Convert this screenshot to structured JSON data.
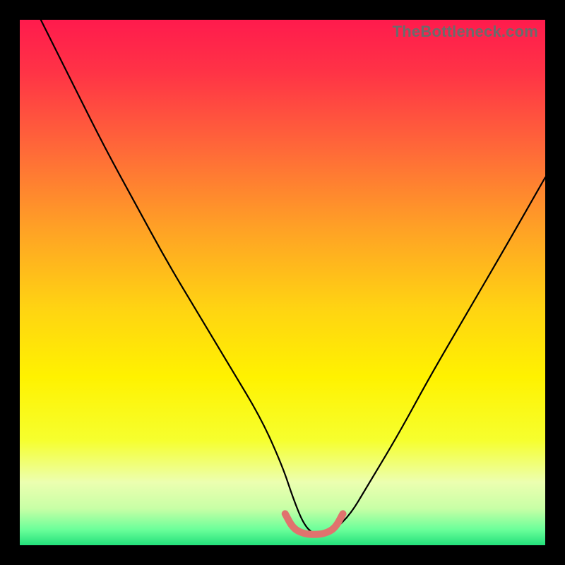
{
  "watermark": "TheBottleneck.com",
  "chart_data": {
    "type": "line",
    "title": "",
    "xlabel": "",
    "ylabel": "",
    "xlim": [
      0,
      100
    ],
    "ylim": [
      0,
      100
    ],
    "series": [
      {
        "name": "bottleneck-curve",
        "x": [
          4,
          10,
          16,
          22,
          28,
          34,
          40,
          46,
          50,
          52,
          54,
          56,
          58,
          60,
          63,
          66,
          72,
          78,
          85,
          92,
          100
        ],
        "y": [
          100,
          88,
          76,
          65,
          54,
          44,
          34,
          24,
          15,
          9,
          4,
          2,
          2,
          3,
          6,
          11,
          21,
          32,
          44,
          56,
          70
        ],
        "color": "#000000"
      },
      {
        "name": "green-zone-marker",
        "x": [
          50.5,
          52,
          54,
          56,
          58,
          60,
          61.5
        ],
        "y": [
          6.0,
          3.2,
          2.2,
          2.0,
          2.2,
          3.2,
          6.0
        ],
        "color": "#e0736e"
      }
    ],
    "background": {
      "type": "vertical-gradient",
      "stops": [
        {
          "pos": 0.0,
          "color": "#ff1b4d"
        },
        {
          "pos": 0.1,
          "color": "#ff3346"
        },
        {
          "pos": 0.25,
          "color": "#ff6a38"
        },
        {
          "pos": 0.4,
          "color": "#ffa225"
        },
        {
          "pos": 0.55,
          "color": "#ffd412"
        },
        {
          "pos": 0.68,
          "color": "#fff200"
        },
        {
          "pos": 0.8,
          "color": "#f6ff2e"
        },
        {
          "pos": 0.88,
          "color": "#ecffb0"
        },
        {
          "pos": 0.93,
          "color": "#c8ffa6"
        },
        {
          "pos": 0.97,
          "color": "#6bff9a"
        },
        {
          "pos": 1.0,
          "color": "#23e07b"
        }
      ]
    }
  }
}
